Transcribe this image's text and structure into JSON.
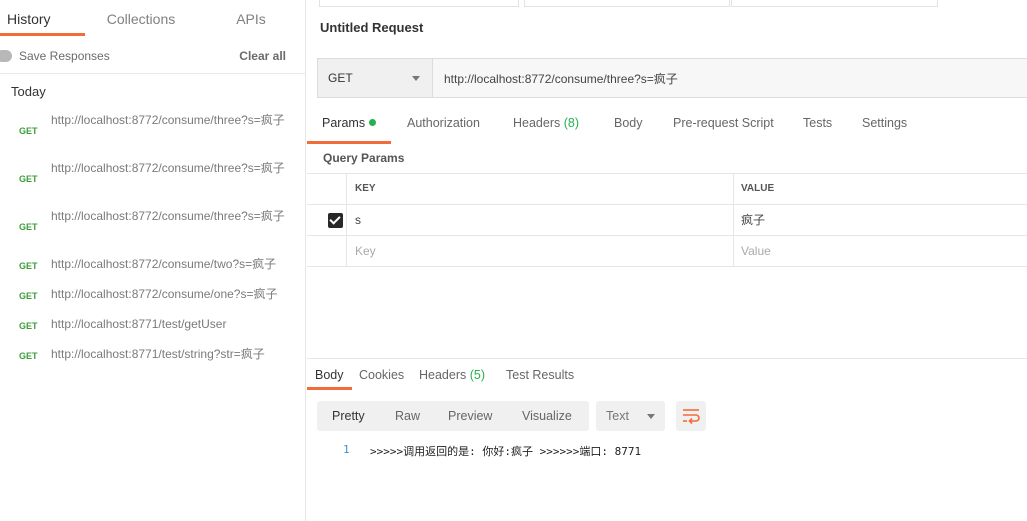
{
  "sidebar": {
    "tabs": [
      "History",
      "Collections",
      "APIs"
    ],
    "save_responses": "Save Responses",
    "clear_all": "Clear all",
    "group_title": "Today",
    "history": [
      {
        "method": "GET",
        "url": "http://localhost:8772/consume/three?s=疯子"
      },
      {
        "method": "GET",
        "url": "http://localhost:8772/consume/three?s=疯子"
      },
      {
        "method": "GET",
        "url": "http://localhost:8772/consume/three?s=疯子"
      },
      {
        "method": "GET",
        "url": "http://localhost:8772/consume/two?s=疯子"
      },
      {
        "method": "GET",
        "url": "http://localhost:8772/consume/one?s=疯子"
      },
      {
        "method": "GET",
        "url": "http://localhost:8771/test/getUser"
      },
      {
        "method": "GET",
        "url": "http://localhost:8771/test/string?str=疯子"
      }
    ]
  },
  "request": {
    "title": "Untitled Request",
    "method": "GET",
    "url": "http://localhost:8772/consume/three?s=疯子",
    "tabs": {
      "params": "Params",
      "authorization": "Authorization",
      "headers": "Headers",
      "headers_count": "(8)",
      "body": "Body",
      "prerequest": "Pre-request Script",
      "tests": "Tests",
      "settings": "Settings"
    },
    "query_params_title": "Query Params",
    "columns": {
      "key": "KEY",
      "value": "VALUE"
    },
    "params": [
      {
        "key": "s",
        "value": "疯子",
        "enabled": true
      }
    ],
    "placeholder": {
      "key": "Key",
      "value": "Value"
    }
  },
  "response": {
    "tabs": {
      "body": "Body",
      "cookies": "Cookies",
      "headers": "Headers",
      "headers_count": "(5)",
      "test_results": "Test Results"
    },
    "formats": [
      "Pretty",
      "Raw",
      "Preview",
      "Visualize"
    ],
    "language": "Text",
    "lines": [
      {
        "num": "1",
        "text": ">>>>>调用返回的是: 你好:疯子 >>>>>>端口: 8771"
      }
    ]
  },
  "colors": {
    "accent": "#f26b3a",
    "get_method": "#3c9d3c",
    "count": "#26b04f"
  }
}
